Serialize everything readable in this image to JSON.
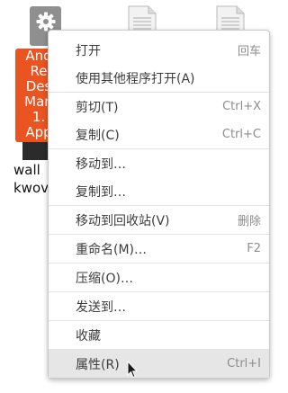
{
  "desktop": {
    "selected_file_label_lines": [
      "And",
      "Re",
      "Des",
      "Man",
      "1.",
      "App"
    ],
    "file_caption_lines": [
      "wall",
      "kwov"
    ]
  },
  "context_menu": {
    "items": [
      {
        "label": "打开",
        "shortcut": "回车"
      },
      {
        "label": "使用其他程序打开(A)",
        "shortcut": ""
      },
      {
        "label": "剪切(T)",
        "shortcut": "Ctrl+X"
      },
      {
        "label": "复制(C)",
        "shortcut": "Ctrl+C"
      },
      {
        "label": "移动到…",
        "shortcut": ""
      },
      {
        "label": "复制到…",
        "shortcut": ""
      },
      {
        "label": "移动到回收站(V)",
        "shortcut": "删除"
      },
      {
        "label": "重命名(M)…",
        "shortcut": "F2"
      },
      {
        "label": "压缩(O)…",
        "shortcut": ""
      },
      {
        "label": "发送到…",
        "shortcut": ""
      },
      {
        "label": "收藏",
        "shortcut": ""
      },
      {
        "label": "属性(R)",
        "shortcut": "Ctrl+I"
      }
    ],
    "highlighted_item": "属性(R)"
  },
  "colors": {
    "selection_accent": "#e95420",
    "menu_highlight": "#e6e6e6",
    "shortcut_text": "#8c8c8c"
  },
  "icons": {
    "settings_app": "gear-icon",
    "documents": "document-icon",
    "pointer": "mouse-cursor-icon"
  }
}
